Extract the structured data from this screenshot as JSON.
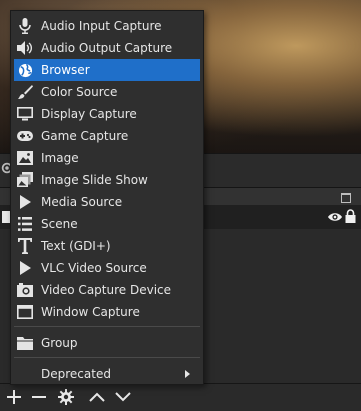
{
  "menu": {
    "items": [
      {
        "label": "Audio Input Capture",
        "icon": "microphone-icon"
      },
      {
        "label": "Audio Output Capture",
        "icon": "speaker-icon"
      },
      {
        "label": "Browser",
        "icon": "globe-icon",
        "selected": true
      },
      {
        "label": "Color Source",
        "icon": "paint-brush-icon"
      },
      {
        "label": "Display Capture",
        "icon": "monitor-icon"
      },
      {
        "label": "Game Capture",
        "icon": "gamepad-icon"
      },
      {
        "label": "Image",
        "icon": "image-icon"
      },
      {
        "label": "Image Slide Show",
        "icon": "slideshow-icon"
      },
      {
        "label": "Media Source",
        "icon": "play-icon"
      },
      {
        "label": "Scene",
        "icon": "list-icon"
      },
      {
        "label": "Text (GDI+)",
        "icon": "text-icon"
      },
      {
        "label": "VLC Video Source",
        "icon": "play-icon"
      },
      {
        "label": "Video Capture Device",
        "icon": "camera-icon"
      },
      {
        "label": "Window Capture",
        "icon": "window-icon"
      }
    ],
    "group_label": "Group",
    "deprecated_label": "Deprecated"
  },
  "colors": {
    "menu_bg": "#2f2f2f",
    "selected": "#1f6fc9",
    "panel_bg": "#2a2a2a"
  },
  "toolbar": {
    "buttons": [
      "add-icon",
      "remove-icon",
      "gear-icon",
      "move-up-icon",
      "move-down-icon"
    ]
  }
}
